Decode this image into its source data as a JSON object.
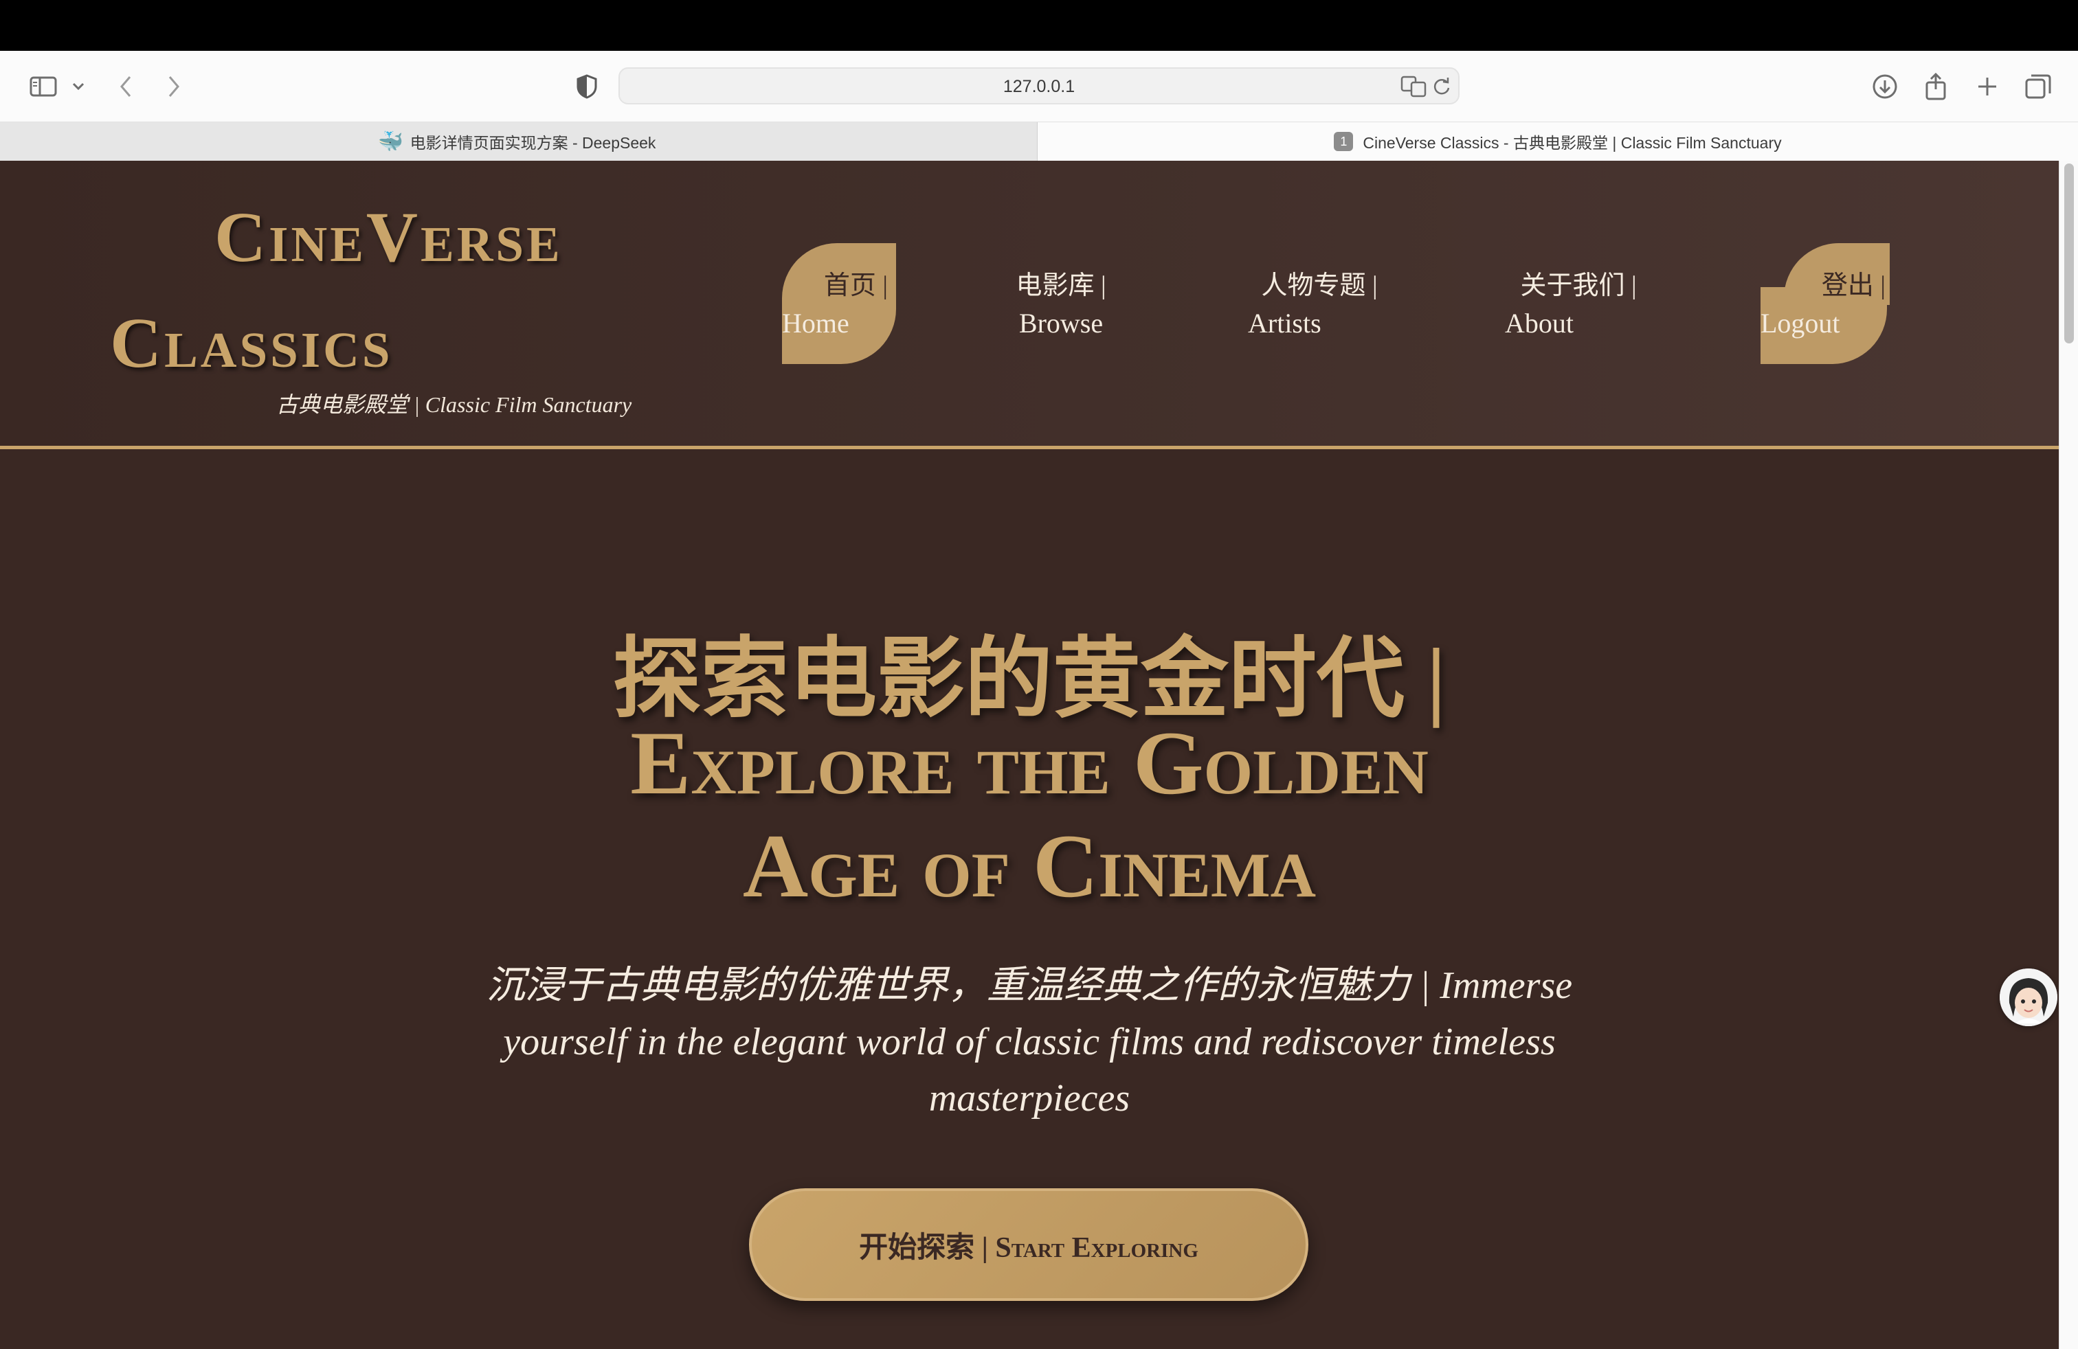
{
  "browser": {
    "address": "127.0.0.1",
    "tabs": [
      {
        "label": "电影详情页面实现方案 - DeepSeek",
        "active": false
      },
      {
        "label": "CineVerse Classics - 古典电影殿堂 | Classic Film Sanctuary",
        "active": true,
        "badge": "1"
      }
    ]
  },
  "site": {
    "logo_line1": "CineVerse",
    "logo_line2": "Classics",
    "tagline": "古典电影殿堂 | Classic Film Sanctuary",
    "nav": [
      {
        "zh": "首页 |",
        "en": "Home"
      },
      {
        "zh": "电影库 |",
        "en": "Browse"
      },
      {
        "zh": "人物专题 |",
        "en": "Artists"
      },
      {
        "zh": "关于我们 |",
        "en": "About"
      },
      {
        "zh": "登出 |",
        "en": "Logout"
      }
    ]
  },
  "hero": {
    "title_zh": "探索电影的黄金时代 |",
    "title_en_1": "Explore the Golden",
    "title_en_2": "Age of Cinema",
    "subtitle": "沉浸于古典电影的优雅世界，重温经典之作的永恒魅力 | Immerse yourself in the elegant world of classic films and rediscover timeless masterpieces",
    "cta_label": "开始探索 | Start Exploring"
  },
  "colors": {
    "background": "#3a2823",
    "gold": "#c9a46a",
    "cream": "#f5ece0"
  }
}
